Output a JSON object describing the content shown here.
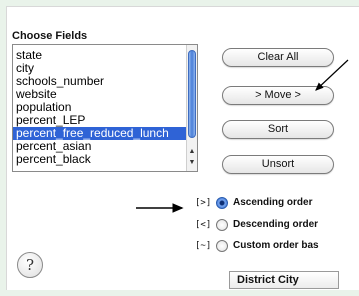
{
  "section_title": "Choose Fields",
  "fields": [
    {
      "label": "state",
      "selected": false
    },
    {
      "label": "city",
      "selected": false
    },
    {
      "label": "schools_number",
      "selected": false
    },
    {
      "label": "website",
      "selected": false
    },
    {
      "label": "population",
      "selected": false
    },
    {
      "label": "percent_LEP",
      "selected": false
    },
    {
      "label": "percent_free_reduced_lunch",
      "selected": true
    },
    {
      "label": "percent_asian",
      "selected": false
    },
    {
      "label": "percent_black",
      "selected": false
    }
  ],
  "scroll": {
    "up_icon": "▲",
    "down_icon": "▼"
  },
  "buttons": {
    "clear_all": "Clear All",
    "move": "> Move >",
    "sort": "Sort",
    "unsort": "Unsort"
  },
  "sort_order": {
    "options": [
      {
        "key": "[>]",
        "label": "Ascending order",
        "checked": true
      },
      {
        "key": "[<]",
        "label": "Descending order",
        "checked": false
      },
      {
        "key": "[~]",
        "label": "Custom order bas",
        "checked": false
      }
    ]
  },
  "sort_field": "District City",
  "help_label": "?",
  "colors": {
    "background": "#e9f3ea",
    "selection": "#2f63d6",
    "annotation": "#000000"
  }
}
